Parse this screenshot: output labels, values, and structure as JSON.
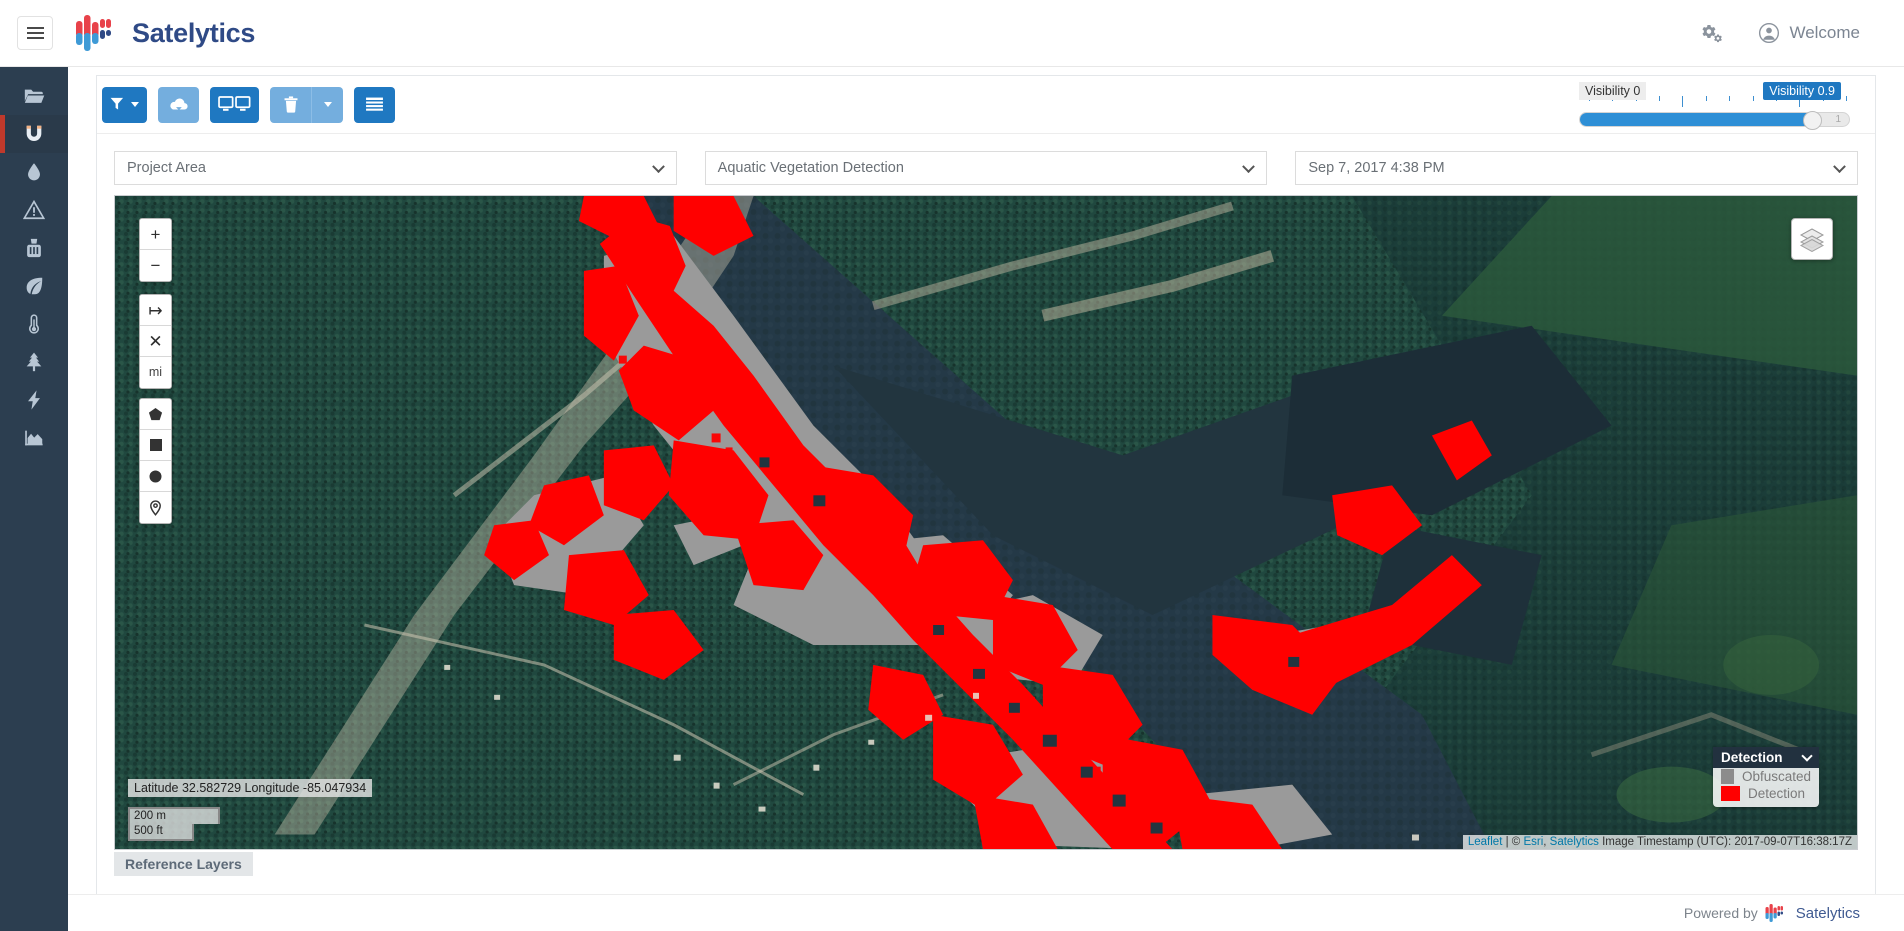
{
  "header": {
    "menu_icon": "hamburger-icon",
    "brand": "Satelytics",
    "settings_icon": "gear-icon",
    "user_icon": "user-avatar-icon",
    "user_label": "Welcome"
  },
  "sidebar": {
    "items": [
      {
        "icon": "folder-open-icon",
        "name": "projects",
        "active": false
      },
      {
        "icon": "magnet-icon",
        "name": "magnet",
        "active": true
      },
      {
        "icon": "water-drop-icon",
        "name": "water",
        "active": false
      },
      {
        "icon": "warning-triangle-icon",
        "name": "alerts",
        "active": false
      },
      {
        "icon": "factory-icon",
        "name": "industry",
        "active": false
      },
      {
        "icon": "leaf-icon",
        "name": "vegetation",
        "active": false
      },
      {
        "icon": "thermometer-icon",
        "name": "temperature",
        "active": false
      },
      {
        "icon": "tree-icon",
        "name": "forestry",
        "active": false
      },
      {
        "icon": "lightning-bolt-icon",
        "name": "energy",
        "active": false
      },
      {
        "icon": "chart-area-icon",
        "name": "analytics",
        "active": false
      }
    ]
  },
  "toolbar": {
    "buttons": [
      {
        "name": "filter-button",
        "icon": "funnel-icon",
        "style": "primary"
      },
      {
        "name": "download-button",
        "icon": "cloud-download-icon",
        "style": "light"
      },
      {
        "name": "compare-button",
        "icon": "dual-screen-icon",
        "style": "primary"
      },
      {
        "name": "delete-button",
        "icon": "trash-icon",
        "style": "light"
      },
      {
        "name": "delete-dropdown-button",
        "icon": "caret-down-icon",
        "style": "light"
      },
      {
        "name": "list-view-button",
        "icon": "list-icon",
        "style": "primary"
      }
    ]
  },
  "visibility": {
    "min_label": "Visibility 0",
    "value_label": "Visibility 0.9",
    "max_tick": "1",
    "value": 0.9
  },
  "selectors": {
    "project_area": {
      "label": "Project Area",
      "placeholder": "Project Area"
    },
    "analytic": {
      "label": "Aquatic Vegetation Detection",
      "placeholder": "Aquatic Vegetation Detection"
    },
    "datetime": {
      "label": "Sep 7, 2017 4:38 PM",
      "placeholder": "Sep 7, 2017 4:38 PM"
    }
  },
  "map": {
    "controls": {
      "zoom_in": "+",
      "zoom_out": "−",
      "measure": "↦",
      "clear_measure": "✕",
      "units": "mi",
      "draw_polygon": "polygon-icon",
      "draw_rectangle": "rectangle-icon",
      "draw_circle": "circle-icon",
      "draw_marker": "map-pin-icon",
      "layers": "layers-stack-icon"
    },
    "coordinates": "Latitude 32.582729 Longitude -85.047934",
    "scale_metric": "200 m",
    "scale_imperial": "500 ft",
    "attribution": {
      "leaflet": "Leaflet",
      "separator": " | ",
      "copyright": "© ",
      "esri": "Esri",
      "comma": ", ",
      "satelytics": "Satelytics",
      "timestamp": " Image Timestamp (UTC): 2017-09-07T16:38:17Z"
    },
    "legend": {
      "title": "Detection",
      "entries": [
        {
          "label": "Obfuscated",
          "color": "#8c8c8c"
        },
        {
          "label": "Detection",
          "color": "#ff0000"
        }
      ]
    }
  },
  "reference_layers": {
    "label": "Reference Layers"
  },
  "footer": {
    "powered_by": "Powered by",
    "brand": "Satelytics"
  },
  "colors": {
    "accent_blue": "#1f78c1",
    "sidebar_bg": "#2c3e50",
    "active_marker": "#c0392b",
    "detection_red": "#ff0000",
    "obfuscated_gray": "#8c8c8c"
  }
}
